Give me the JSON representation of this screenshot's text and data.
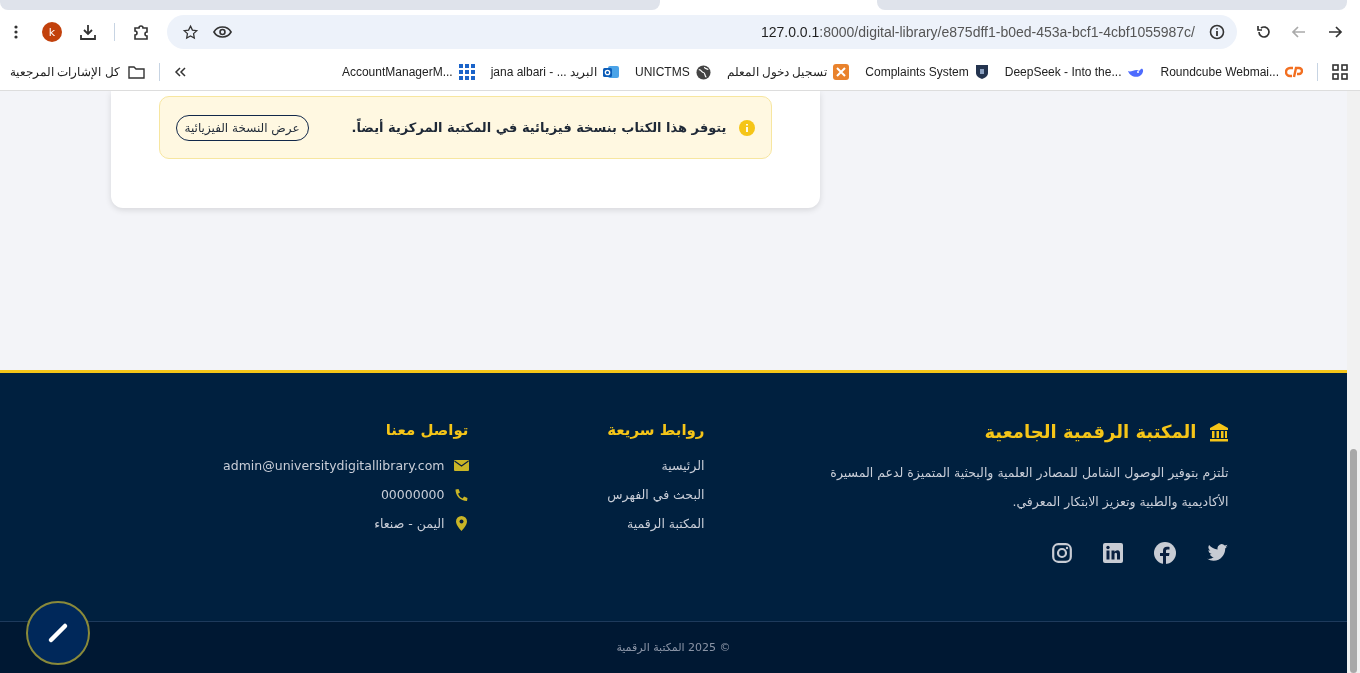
{
  "browser": {
    "url_host": "127.0.0.1",
    "url_path": ":8000/digital-library/e875dff1-b0ed-453a-bcf1-4cbf1055987c/",
    "avatar": "k",
    "all_bookmarks": "كل الإشارات المرجعية",
    "bookmarks": [
      {
        "label": "Roundcube Webmai...",
        "kind": "cpanel"
      },
      {
        "label": "DeepSeek - Into the...",
        "kind": "whale"
      },
      {
        "label": "Complaints System",
        "kind": "shield"
      },
      {
        "label": "تسجيل دخول المعلم",
        "kind": "xampp"
      },
      {
        "label": "UNICTMS",
        "kind": "globe"
      },
      {
        "label": "jana albari - ... البريد",
        "kind": "outlook"
      },
      {
        "label": "AccountManagerM...",
        "kind": "grid"
      }
    ]
  },
  "notice": {
    "text": "يتوفر هذا الكتاب بنسخة فيزيائية في المكتبة المركزية أيضاً.",
    "button": "عرض النسخة الفيزيائية"
  },
  "footer": {
    "brand": "المكتبة الرقمية الجامعية",
    "description": "تلتزم بتوفير الوصول الشامل للمصادر العلمية والبحثية المتميزة لدعم المسيرة الأكاديمية والطبية وتعزيز الابتكار المعرفي.",
    "social": [
      {
        "kind": "twitter"
      },
      {
        "kind": "facebook"
      },
      {
        "kind": "linkedin"
      },
      {
        "kind": "instagram"
      }
    ],
    "quick_links": {
      "title": "روابط سريعة",
      "items": [
        "الرئيسية",
        "البحث في الفهرس",
        "المكتبة الرقمية"
      ]
    },
    "contact": {
      "title": "تواصل معنا",
      "items": [
        {
          "kind": "email",
          "text": "admin@universitydigitallibrary.com"
        },
        {
          "kind": "phone",
          "text": "00000000"
        },
        {
          "kind": "location",
          "text": "اليمن - صنعاء"
        }
      ]
    },
    "copyright": "© 2025 المكتبة الرقمية"
  }
}
